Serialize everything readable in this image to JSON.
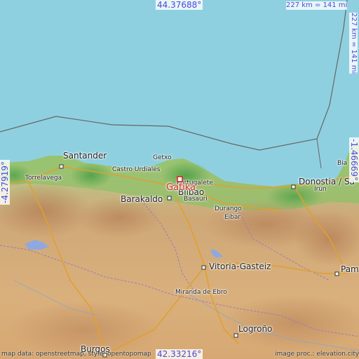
{
  "coords": {
    "top": "44.37688°",
    "bottom": "42.33216°",
    "left": "-4.27919°",
    "right": "-1.46669°"
  },
  "scale": {
    "top": "227 km = 141 mi",
    "right": "227 km = 141 mi"
  },
  "marker": {
    "name": "Gatika"
  },
  "places": {
    "santander": "Santander",
    "torrelavega": "Torrelavega",
    "castro": "Castro Urdiales",
    "getxo": "Getxo",
    "portugalete": "Portugalete",
    "bilbao": "Bilbao",
    "barakaldo": "Barakaldo",
    "basauri": "Basauri",
    "durango": "Durango",
    "eibar": "Eibar",
    "donostia": "Donostia / Sa",
    "irun": "Irun",
    "biarritz": "Bia",
    "vitoria": "Vitoria-Gasteiz",
    "miranda": "Miranda de Ebro",
    "logrono": "Logroño",
    "burgos": "Burgos",
    "pamplona": "Pam"
  },
  "attribution": {
    "left": "map data: openstreetmap, style: opentopomap",
    "right": "image proc.: elevation.city"
  },
  "colors": {
    "sea": "#8fd0e0",
    "marker": "#d42a2a",
    "coords": "#4a4ad6"
  }
}
